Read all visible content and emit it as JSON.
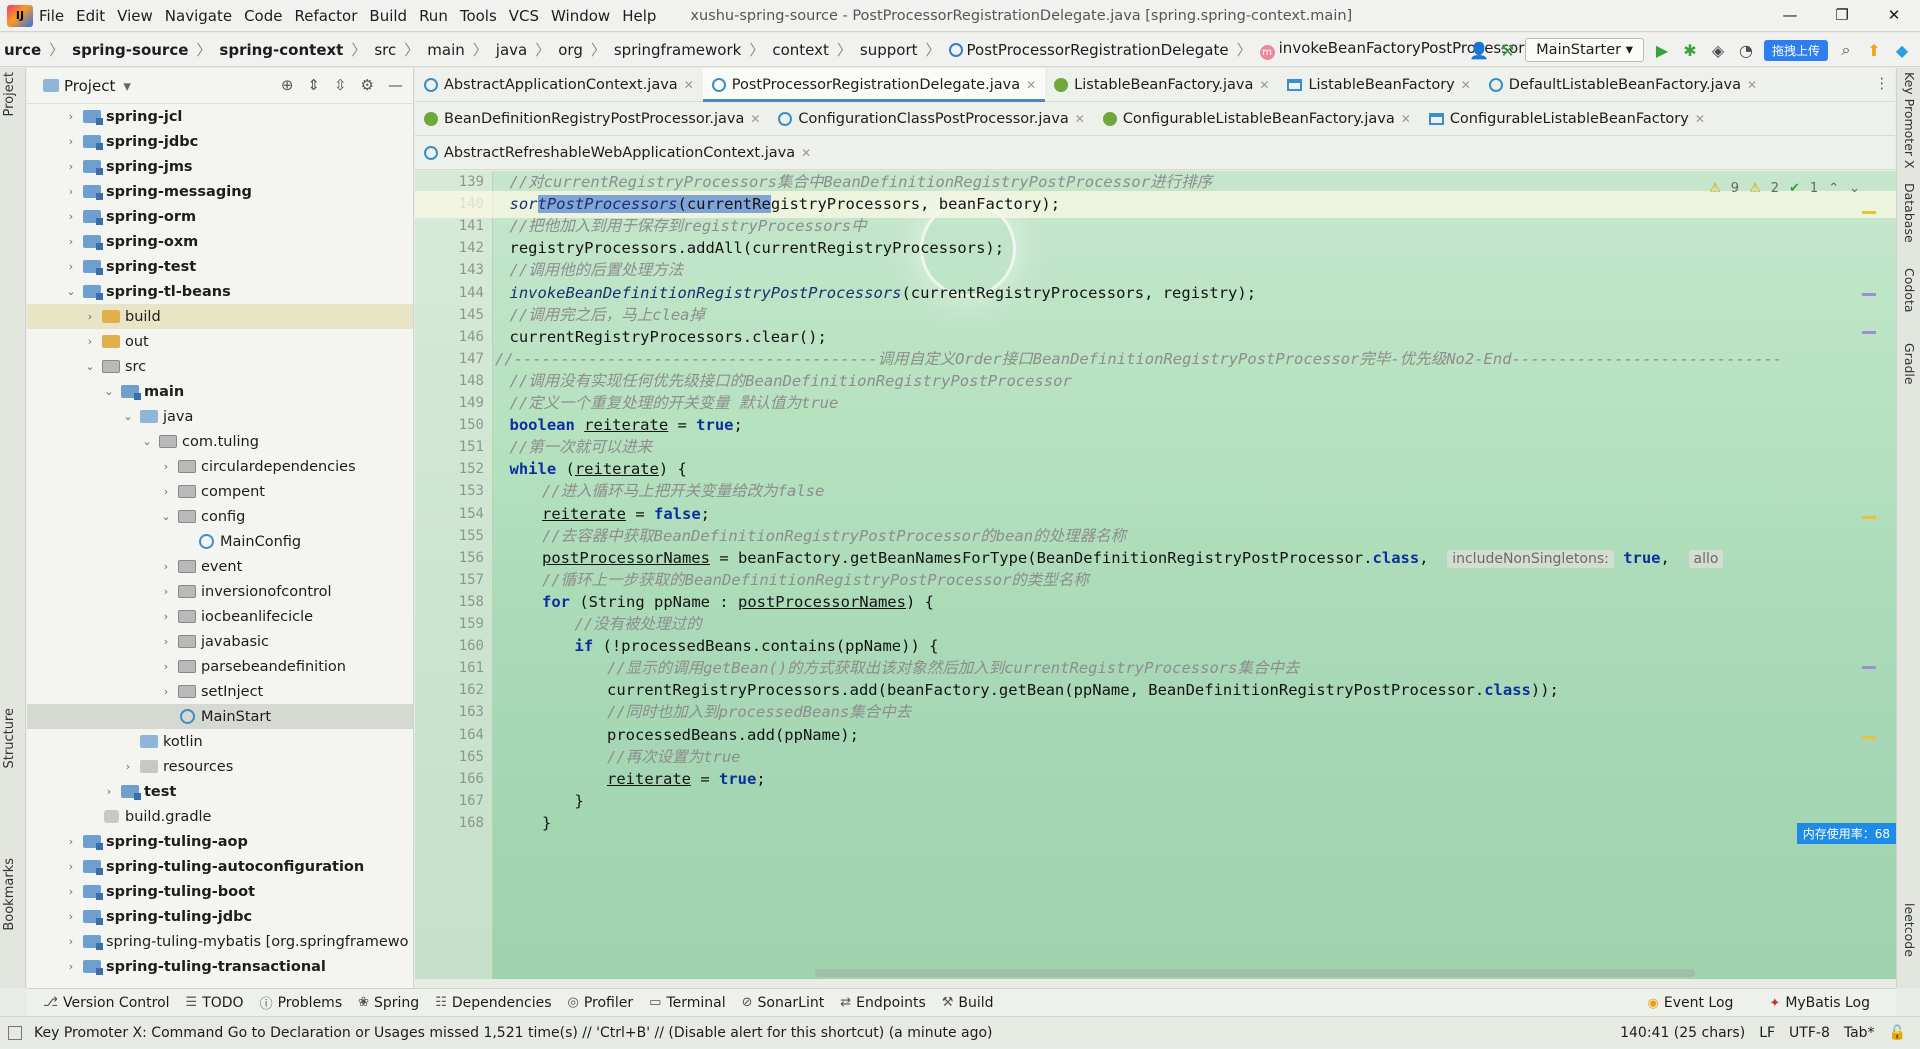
{
  "menubar": {
    "items": [
      "File",
      "Edit",
      "View",
      "Navigate",
      "Code",
      "Refactor",
      "Build",
      "Run",
      "Tools",
      "VCS",
      "Window",
      "Help"
    ],
    "title": "xushu-spring-source - PostProcessorRegistrationDelegate.java [spring.spring-context.main]"
  },
  "breadcrumb": {
    "items": [
      "urce",
      "spring-source",
      "spring-context",
      "src",
      "main",
      "java",
      "org",
      "springframework",
      "context",
      "support",
      "PostProcessorRegistrationDelegate",
      "invokeBeanFactoryPostProcessors"
    ]
  },
  "toolbar": {
    "run_config": "MainStarter",
    "upload_label": "拖拽上传"
  },
  "project": {
    "title": "Project",
    "tree": [
      {
        "label": "spring-jcl",
        "depth": 0,
        "type": "mod",
        "arrow": "›"
      },
      {
        "label": "spring-jdbc",
        "depth": 0,
        "type": "mod",
        "arrow": "›"
      },
      {
        "label": "spring-jms",
        "depth": 0,
        "type": "mod",
        "arrow": "›"
      },
      {
        "label": "spring-messaging",
        "depth": 0,
        "type": "mod",
        "arrow": "›"
      },
      {
        "label": "spring-orm",
        "depth": 0,
        "type": "mod",
        "arrow": "›"
      },
      {
        "label": "spring-oxm",
        "depth": 0,
        "type": "mod",
        "arrow": "›"
      },
      {
        "label": "spring-test",
        "depth": 0,
        "type": "mod",
        "arrow": "›"
      },
      {
        "label": "spring-tl-beans",
        "depth": 0,
        "type": "mod",
        "arrow": "⌄"
      },
      {
        "label": "build",
        "depth": 1,
        "type": "y",
        "arrow": "›",
        "sel": true
      },
      {
        "label": "out",
        "depth": 1,
        "type": "y",
        "arrow": "›"
      },
      {
        "label": "src",
        "depth": 1,
        "type": "pkg",
        "arrow": "⌄"
      },
      {
        "label": "main",
        "depth": 2,
        "type": "mod",
        "arrow": "⌄",
        "bold": true
      },
      {
        "label": "java",
        "depth": 3,
        "type": "src",
        "arrow": "⌄"
      },
      {
        "label": "com.tuling",
        "depth": 4,
        "type": "pkg",
        "arrow": "⌄"
      },
      {
        "label": "circulardependencies",
        "depth": 5,
        "type": "pkg",
        "arrow": "›"
      },
      {
        "label": "compent",
        "depth": 5,
        "type": "pkg",
        "arrow": "›"
      },
      {
        "label": "config",
        "depth": 5,
        "type": "pkg",
        "arrow": "⌄"
      },
      {
        "label": "MainConfig",
        "depth": 6,
        "type": "class",
        "arrow": ""
      },
      {
        "label": "event",
        "depth": 5,
        "type": "pkg",
        "arrow": "›"
      },
      {
        "label": "inversionofcontrol",
        "depth": 5,
        "type": "pkg",
        "arrow": "›"
      },
      {
        "label": "iocbeanlifecicle",
        "depth": 5,
        "type": "pkg",
        "arrow": "›"
      },
      {
        "label": "javabasic",
        "depth": 5,
        "type": "pkg",
        "arrow": "›"
      },
      {
        "label": "parsebeandefinition",
        "depth": 5,
        "type": "pkg",
        "arrow": "›"
      },
      {
        "label": "setInject",
        "depth": 5,
        "type": "pkg",
        "arrow": "›"
      },
      {
        "label": "MainStart",
        "depth": 5,
        "type": "class",
        "arrow": "",
        "cur": true
      },
      {
        "label": "kotlin",
        "depth": 3,
        "type": "src",
        "arrow": ""
      },
      {
        "label": "resources",
        "depth": 3,
        "type": "res",
        "arrow": "›"
      },
      {
        "label": "test",
        "depth": 2,
        "type": "mod",
        "arrow": "›",
        "bold": true
      },
      {
        "label": "build.gradle",
        "depth": 1,
        "type": "gradle",
        "arrow": ""
      },
      {
        "label": "spring-tuling-aop",
        "depth": 0,
        "type": "mod",
        "arrow": "›"
      },
      {
        "label": "spring-tuling-autoconfiguration",
        "depth": 0,
        "type": "mod",
        "arrow": "›"
      },
      {
        "label": "spring-tuling-boot",
        "depth": 0,
        "type": "mod",
        "arrow": "›"
      },
      {
        "label": "spring-tuling-jdbc",
        "depth": 0,
        "type": "mod",
        "arrow": "›"
      },
      {
        "label": "spring-tuling-mybatis [org.springframewo",
        "depth": 0,
        "type": "mod",
        "arrow": "›",
        "plain": true
      },
      {
        "label": "spring-tuling-transactional",
        "depth": 0,
        "type": "mod",
        "arrow": "›"
      }
    ]
  },
  "tabs": {
    "row1": [
      {
        "label": "AbstractApplicationContext.java",
        "icon": "c"
      },
      {
        "label": "PostProcessorRegistrationDelegate.java",
        "icon": "c",
        "active": true
      },
      {
        "label": "ListableBeanFactory.java",
        "icon": "i"
      },
      {
        "label": "ListableBeanFactory",
        "icon": "d"
      },
      {
        "label": "DefaultListableBeanFactory.java",
        "icon": "c"
      }
    ],
    "row2": [
      {
        "label": "BeanDefinitionRegistryPostProcessor.java",
        "icon": "i"
      },
      {
        "label": "ConfigurationClassPostProcessor.java",
        "icon": "c"
      },
      {
        "label": "ConfigurableListableBeanFactory.java",
        "icon": "i"
      },
      {
        "label": "ConfigurableListableBeanFactory",
        "icon": "d"
      }
    ],
    "row3": [
      {
        "label": "AbstractRefreshableWebApplicationContext.java",
        "icon": "c"
      }
    ]
  },
  "inspection": {
    "warnings": "9",
    "weak": "2",
    "ok": "1"
  },
  "code": {
    "lines": [
      {
        "n": "139",
        "indent": 3,
        "html": "<span class='cm'>//对currentRegistryProcessors集合中BeanDefinitionRegistryPostProcessor进行排序</span>"
      },
      {
        "n": "140",
        "indent": 3,
        "cur": true,
        "html": "<span class='fn'>sor</span><span class='fn sel-text'>tPostProcessors</span><span class='sel-text'>(currentRe</span>gistryProcessors, beanFactory);"
      },
      {
        "n": "141",
        "indent": 3,
        "html": "<span class='cm'>//把他加入到用于保存到registryProcessors中</span>"
      },
      {
        "n": "142",
        "indent": 3,
        "html": "registryProcessors.addAll(currentRegistryProcessors);"
      },
      {
        "n": "143",
        "indent": 3,
        "html": "<span class='cm'>//调用他的后置处理方法</span>"
      },
      {
        "n": "144",
        "indent": 3,
        "html": "<span class='fn'>invokeBeanDefinitionRegistryPostProcessors</span>(currentRegistryProcessors, registry);"
      },
      {
        "n": "145",
        "indent": 3,
        "html": "<span class='cm'>//调用完之后，马上clea掉</span>"
      },
      {
        "n": "146",
        "indent": 3,
        "html": "currentRegistryProcessors.clear();"
      },
      {
        "n": "147",
        "indent": 0,
        "html": "<span class='cm'>//---------------------------------------调用自定义Order接口BeanDefinitionRegistryPostProcessor完毕-优先级No2-End-----------------------------</span>"
      },
      {
        "n": "148",
        "indent": 3,
        "html": "<span class='cm'>//调用没有实现任何优先级接口的BeanDefinitionRegistryPostProcessor</span>"
      },
      {
        "n": "149",
        "indent": 3,
        "html": "<span class='cm'>//定义一个重复处理的开关变量 默认值为true</span>"
      },
      {
        "n": "150",
        "indent": 3,
        "html": "<span class='kw'>boolean</span> <span class='var'>reiterate</span> = <span class='kw'>true</span>;"
      },
      {
        "n": "151",
        "indent": 3,
        "html": "<span class='cm'>//第一次就可以进来</span>"
      },
      {
        "n": "152",
        "indent": 3,
        "html": "<span class='kw'>while</span> (<span class='var'>reiterate</span>) {"
      },
      {
        "n": "153",
        "indent": 4,
        "html": "<span class='cm'>//进入循环马上把开关变量给改为false</span>"
      },
      {
        "n": "154",
        "indent": 4,
        "html": "<span class='var'>reiterate</span> = <span class='kw'>false</span>;"
      },
      {
        "n": "155",
        "indent": 4,
        "html": "<span class='cm'>//去容器中获取BeanDefinitionRegistryPostProcessor的bean的处理器名称</span>"
      },
      {
        "n": "156",
        "indent": 4,
        "html": "<span class='var'>postProcessorNames</span> = beanFactory.getBeanNamesForType(BeanDefinitionRegistryPostProcessor.<span class='kw'>class</span>,  <span class='hint'>includeNonSingletons:</span> <span class='kw'>true</span>,  <span class='hint'>allo</span>"
      },
      {
        "n": "157",
        "indent": 4,
        "html": "<span class='cm'>//循环上一步获取的BeanDefinitionRegistryPostProcessor的类型名称</span>"
      },
      {
        "n": "158",
        "indent": 4,
        "html": "<span class='kw'>for</span> (String ppName : <span class='var'>postProcessorNames</span>) {"
      },
      {
        "n": "159",
        "indent": 5,
        "html": "<span class='cm'>//没有被处理过的</span>"
      },
      {
        "n": "160",
        "indent": 5,
        "html": "<span class='kw'>if</span> (!processedBeans.contains(ppName)) {"
      },
      {
        "n": "161",
        "indent": 6,
        "html": "<span class='cm'>//显示的调用getBean()的方式获取出该对象然后加入到currentRegistryProcessors集合中去</span>"
      },
      {
        "n": "162",
        "indent": 6,
        "html": "currentRegistryProcessors.add(beanFactory.getBean(ppName, BeanDefinitionRegistryPostProcessor.<span class='kw'>class</span>));"
      },
      {
        "n": "163",
        "indent": 6,
        "html": "<span class='cm'>//同时也加入到processedBeans集合中去</span>"
      },
      {
        "n": "164",
        "indent": 6,
        "html": "processedBeans.add(ppName);"
      },
      {
        "n": "165",
        "indent": 6,
        "html": "<span class='cm'>//再次设置为true</span>"
      },
      {
        "n": "166",
        "indent": 6,
        "html": "<span class='var'>reiterate</span> = <span class='kw'>true</span>;"
      },
      {
        "n": "167",
        "indent": 5,
        "html": "}"
      },
      {
        "n": "168",
        "indent": 4,
        "html": "}"
      }
    ]
  },
  "left_strip": {
    "project": "Project",
    "structure": "Structure",
    "bookmarks": "Bookmarks"
  },
  "right_strip": {
    "key_promoter": "Key Promoter X",
    "database": "Database",
    "codota": "Codota",
    "gradle": "Gradle",
    "leetcode": "leetcode"
  },
  "memory_badge": "内存使用率：68",
  "bottom_tools": {
    "left": [
      "Version Control",
      "TODO",
      "Problems",
      "Spring",
      "Dependencies",
      "Profiler",
      "Terminal",
      "SonarLint",
      "Endpoints",
      "Build"
    ],
    "right": [
      "Event Log",
      "MyBatis Log"
    ]
  },
  "statusbar": {
    "message": "Key Promoter X: Command Go to Declaration or Usages missed 1,521 time(s) // 'Ctrl+B' // (Disable alert for this shortcut) (a minute ago)",
    "position": "140:41 (25 chars)",
    "line_sep": "LF",
    "encoding": "UTF-8",
    "indent": "Tab*"
  }
}
